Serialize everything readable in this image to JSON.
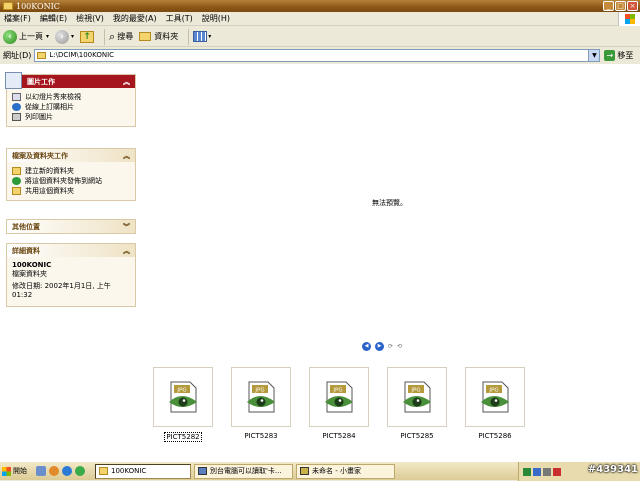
{
  "window": {
    "title": "100KONIC"
  },
  "menu": [
    "檔案(F)",
    "編輯(E)",
    "檢視(V)",
    "我的最愛(A)",
    "工具(T)",
    "說明(H)"
  ],
  "toolbar": {
    "back": "上一頁",
    "search": "搜尋",
    "folders": "資料夾"
  },
  "address": {
    "label": "網址(D)",
    "path": "L:\\DCIM\\100KONIC",
    "go": "移至"
  },
  "tasks": {
    "picture": {
      "title": "圖片工作",
      "items": [
        "以幻燈片秀來檢視",
        "從線上訂購相片",
        "列印圖片"
      ]
    },
    "file": {
      "title": "檔案及資料夾工作",
      "items": [
        "建立新的資料夾",
        "將這個資料夾發佈到網站",
        "共用這個資料夾"
      ]
    },
    "other": {
      "title": "其他位置"
    },
    "details": {
      "title": "詳細資料",
      "name": "100KONIC",
      "type": "檔案資料夾",
      "modified": "修改日期: 2002年1月1日, 上午 01:32"
    }
  },
  "preview": {
    "message": "無法預覽。"
  },
  "thumbnails": [
    {
      "label": "PICT5282",
      "badge": "JPG"
    },
    {
      "label": "PICT5283",
      "badge": "JPG"
    },
    {
      "label": "PICT5284",
      "badge": "JPG"
    },
    {
      "label": "PICT5285",
      "badge": "JPG"
    },
    {
      "label": "PICT5286",
      "badge": "JPG"
    }
  ],
  "taskbar": {
    "start": "開始",
    "buttons": [
      "100KONIC",
      "別台電腦可以讀取'卡...",
      "未命名 - 小畫家"
    ],
    "stamp": "#439341"
  },
  "colors": {
    "title_bar": "#8c5716",
    "panel_red": "#a5161e",
    "taskbar": "#dccb95"
  }
}
